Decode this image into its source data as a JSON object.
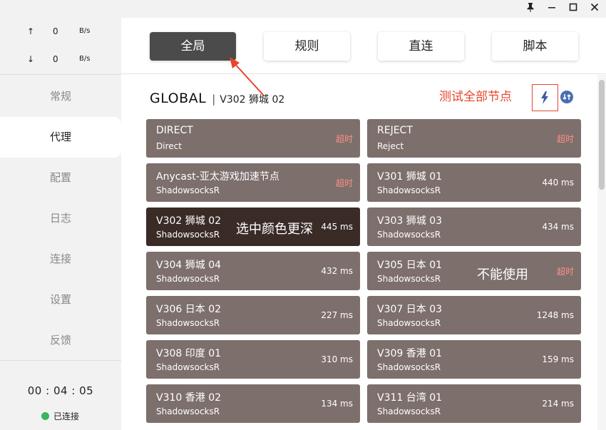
{
  "window": {
    "pin_icon": "pin-icon",
    "minimize_icon": "minimize-icon",
    "maximize_icon": "maximize-icon",
    "close_icon": "close-icon"
  },
  "traffic": {
    "up": {
      "arrow": "↑",
      "value": "0",
      "unit": "B/s"
    },
    "down": {
      "arrow": "↓",
      "value": "0",
      "unit": "B/s"
    }
  },
  "nav": [
    {
      "label": "常规"
    },
    {
      "label": "代理"
    },
    {
      "label": "配置"
    },
    {
      "label": "日志"
    },
    {
      "label": "连接"
    },
    {
      "label": "设置"
    },
    {
      "label": "反馈"
    }
  ],
  "nav_active_index": 1,
  "status": {
    "timer": "00 : 04 : 05",
    "label": "已连接",
    "color": "#39b55d"
  },
  "modes": [
    {
      "label": "全局",
      "active": true
    },
    {
      "label": "规则",
      "active": false
    },
    {
      "label": "直连",
      "active": false
    },
    {
      "label": "脚本",
      "active": false
    }
  ],
  "group": {
    "name": "GLOBAL",
    "separator": "|",
    "selected": "V302 狮城 02"
  },
  "annotations": {
    "test_all": "测试全部节点",
    "selected_note": "选中颜色更深",
    "unusable_note": "不能使用"
  },
  "proxies": [
    {
      "name": "DIRECT",
      "type": "Direct",
      "latency": "超时",
      "timeout": true
    },
    {
      "name": "REJECT",
      "type": "Reject",
      "latency": "超时",
      "timeout": true
    },
    {
      "name": "Anycast-亚太游戏加速节点",
      "type": "ShadowsocksR",
      "latency": "超时",
      "timeout": true
    },
    {
      "name": "V301 狮城 01",
      "type": "ShadowsocksR",
      "latency": "440 ms"
    },
    {
      "name": "V302 狮城 02",
      "type": "ShadowsocksR",
      "latency": "445 ms",
      "selected": true
    },
    {
      "name": "V303 狮城 03",
      "type": "ShadowsocksR",
      "latency": "434 ms"
    },
    {
      "name": "V304 狮城 04",
      "type": "ShadowsocksR",
      "latency": "432 ms"
    },
    {
      "name": "V305 日本 01",
      "type": "ShadowsocksR",
      "latency": "超时",
      "timeout": true
    },
    {
      "name": "V306 日本 02",
      "type": "ShadowsocksR",
      "latency": "227 ms"
    },
    {
      "name": "V307 日本 03",
      "type": "ShadowsocksR",
      "latency": "1248 ms"
    },
    {
      "name": "V308 印度 01",
      "type": "ShadowsocksR",
      "latency": "310 ms"
    },
    {
      "name": "V309 香港 01",
      "type": "ShadowsocksR",
      "latency": "159 ms"
    },
    {
      "name": "V310 香港 02",
      "type": "ShadowsocksR",
      "latency": "134 ms"
    },
    {
      "name": "V311 台湾 01",
      "type": "ShadowsocksR",
      "latency": "214 ms"
    }
  ],
  "colors": {
    "card": "#7d6f6c",
    "card_selected": "#3a2b27",
    "annotation": "#e8452c",
    "timeout": "#ff8f86"
  }
}
